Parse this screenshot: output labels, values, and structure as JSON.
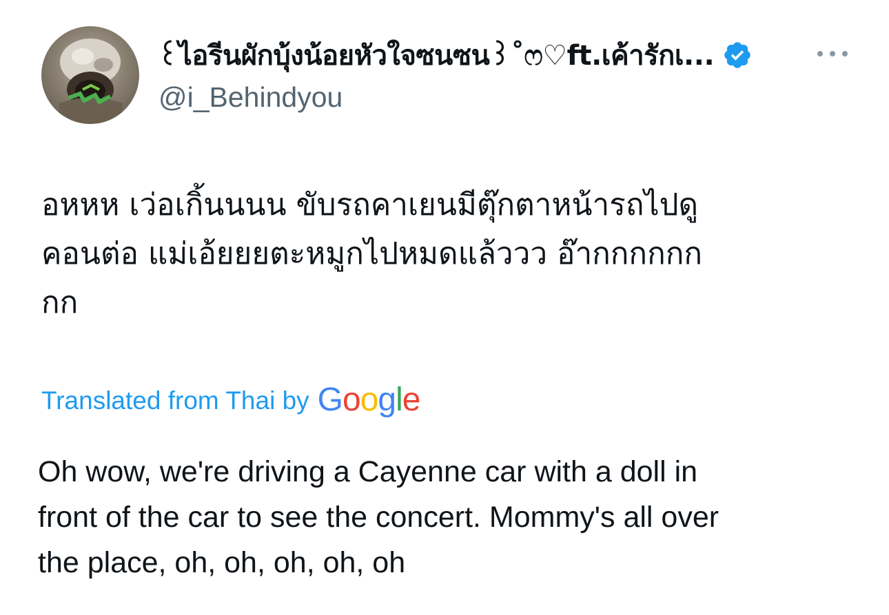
{
  "author": {
    "display_name": "꒰ไอรีนผักบุ้งน้อยหัวใจซนซน꒱˚ෆ♡ft.เค้ารักเ...",
    "handle": "@i_Behindyou",
    "verified": true,
    "avatar_icon": "avatar-image",
    "more_icon": "more-options-icon"
  },
  "tweet": {
    "lines": [
      "อหหห เว่อเกิ้นนนน ขับรถคาเยนมีตุ๊กตาหน้ารถไปดู",
      "คอนต่อ แม่เอ้ยยยตะหมูกไปหมดแล้ววว อ๊ากกกกกก",
      "กก"
    ]
  },
  "translation": {
    "label": "Translated from Thai by",
    "provider": "Google",
    "lines": [
      "Oh wow, we're driving a Cayenne car with a doll in",
      "front of the car to see the concert. Mommy's all over",
      "the place, oh, oh, oh, oh, oh"
    ]
  },
  "colors": {
    "accent": "#1d9bf0",
    "text_primary": "#0f1419",
    "text_secondary": "#536471",
    "google_blue": "#4285f4",
    "google_red": "#ea4335",
    "google_yellow": "#fbbc05",
    "google_green": "#34a853"
  }
}
